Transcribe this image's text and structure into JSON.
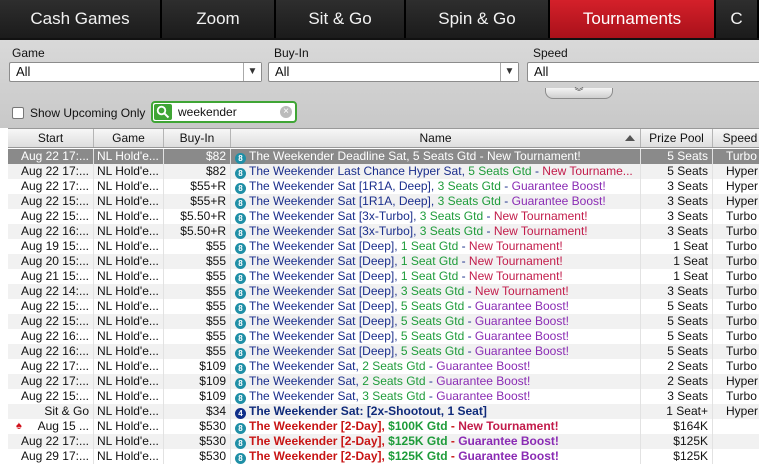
{
  "tabs": [
    {
      "label": "Cash Games",
      "width": 162,
      "active": false
    },
    {
      "label": "Zoom",
      "width": 114,
      "active": false
    },
    {
      "label": "Sit & Go",
      "width": 130,
      "active": false
    },
    {
      "label": "Spin & Go",
      "width": 144,
      "active": false
    },
    {
      "label": "Tournaments",
      "width": 166,
      "active": true
    },
    {
      "label": "C",
      "width": 43,
      "active": false
    }
  ],
  "filters": {
    "game": {
      "label": "Game",
      "value": "All"
    },
    "buyin": {
      "label": "Buy-In",
      "value": "All"
    },
    "speed": {
      "label": "Speed",
      "value": "All"
    },
    "show_upcoming_label": "Show Upcoming Only",
    "search_value": "weekender"
  },
  "columns": {
    "start": "Start",
    "game": "Game",
    "buyin": "Buy-In",
    "name": "Name",
    "prize": "Prize Pool",
    "speed": "Speed"
  },
  "colors": {
    "seats": "#1e9c3a",
    "boost": "#8a2bb4",
    "new_tournament": "#c21b4a",
    "name": "#1a2e8c",
    "red_name": "#c81515",
    "tab_active": "#c0161f",
    "search_border": "#3fa535"
  },
  "rows": [
    {
      "start": "Aug 22  17:...",
      "game": "NL Hold'e...",
      "buyin": "$82",
      "name": "The Weekender Deadline Sat",
      "seats": "5 Seats Gtd",
      "status": "New Tournament!",
      "prize": "5 Seats",
      "speed": "Turbo",
      "selected": true,
      "badge": "8"
    },
    {
      "start": "Aug 22  17:...",
      "game": "NL Hold'e...",
      "buyin": "$82",
      "name": "The Weekender Last Chance Hyper Sat",
      "seats": "5 Seats Gtd",
      "status": "New Tourname...",
      "prize": "5 Seats",
      "speed": "Hyper",
      "badge": "8"
    },
    {
      "start": "Aug 22  17:...",
      "game": "NL Hold'e...",
      "buyin": "$55+R",
      "name": "The Weekender Sat [1R1A, Deep]",
      "seats": "3 Seats Gtd",
      "status": "Guarantee Boost!",
      "prize": "3 Seats",
      "speed": "Hyper",
      "badge": "8"
    },
    {
      "start": "Aug 22  15:...",
      "game": "NL Hold'e...",
      "buyin": "$55+R",
      "name": "The Weekender Sat [1R1A, Deep]",
      "seats": "3 Seats Gtd",
      "status": "Guarantee Boost!",
      "prize": "3 Seats",
      "speed": "Hyper",
      "badge": "8"
    },
    {
      "start": "Aug 22  15:...",
      "game": "NL Hold'e...",
      "buyin": "$5.50+R",
      "name": "The Weekender Sat [3x-Turbo]",
      "seats": "3 Seats Gtd",
      "status": "New Tournament!",
      "prize": "3 Seats",
      "speed": "Turbo",
      "badge": "8"
    },
    {
      "start": "Aug 22  16:...",
      "game": "NL Hold'e...",
      "buyin": "$5.50+R",
      "name": "The Weekender Sat [3x-Turbo]",
      "seats": "3 Seats Gtd",
      "status": "New Tournament!",
      "prize": "3 Seats",
      "speed": "Turbo",
      "badge": "8"
    },
    {
      "start": "Aug 19  15:...",
      "game": "NL Hold'e...",
      "buyin": "$55",
      "name": "The Weekender Sat [Deep]",
      "seats": "1 Seat Gtd",
      "status": "New Tournament!",
      "prize": "1 Seat",
      "speed": "Turbo",
      "badge": "8"
    },
    {
      "start": "Aug 20  15:...",
      "game": "NL Hold'e...",
      "buyin": "$55",
      "name": "The Weekender Sat [Deep]",
      "seats": "1 Seat Gtd",
      "status": "New Tournament!",
      "prize": "1 Seat",
      "speed": "Turbo",
      "badge": "8"
    },
    {
      "start": "Aug 21  15:...",
      "game": "NL Hold'e...",
      "buyin": "$55",
      "name": "The Weekender Sat [Deep]",
      "seats": "1 Seat Gtd",
      "status": "New Tournament!",
      "prize": "1 Seat",
      "speed": "Turbo",
      "badge": "8"
    },
    {
      "start": "Aug 22  14:...",
      "game": "NL Hold'e...",
      "buyin": "$55",
      "name": "The Weekender Sat [Deep]",
      "seats": "3 Seats Gtd",
      "status": "New Tournament!",
      "prize": "3 Seats",
      "speed": "Turbo",
      "badge": "8"
    },
    {
      "start": "Aug 22  15:...",
      "game": "NL Hold'e...",
      "buyin": "$55",
      "name": "The Weekender Sat [Deep]",
      "seats": "5 Seats Gtd",
      "status": "Guarantee Boost!",
      "prize": "5 Seats",
      "speed": "Turbo",
      "badge": "8"
    },
    {
      "start": "Aug 22  15:...",
      "game": "NL Hold'e...",
      "buyin": "$55",
      "name": "The Weekender Sat [Deep]",
      "seats": "5 Seats Gtd",
      "status": "Guarantee Boost!",
      "prize": "5 Seats",
      "speed": "Turbo",
      "badge": "8"
    },
    {
      "start": "Aug 22  16:...",
      "game": "NL Hold'e...",
      "buyin": "$55",
      "name": "The Weekender Sat [Deep]",
      "seats": "5 Seats Gtd",
      "status": "Guarantee Boost!",
      "prize": "5 Seats",
      "speed": "Turbo",
      "badge": "8"
    },
    {
      "start": "Aug 22  16:...",
      "game": "NL Hold'e...",
      "buyin": "$55",
      "name": "The Weekender Sat [Deep]",
      "seats": "5 Seats Gtd",
      "status": "Guarantee Boost!",
      "prize": "5 Seats",
      "speed": "Turbo",
      "badge": "8"
    },
    {
      "start": "Aug 22  17:...",
      "game": "NL Hold'e...",
      "buyin": "$109",
      "name": "The Weekender Sat",
      "seats": "2 Seats Gtd",
      "status": "Guarantee Boost!",
      "prize": "2 Seats",
      "speed": "Turbo",
      "badge": "8"
    },
    {
      "start": "Aug 22  17:...",
      "game": "NL Hold'e...",
      "buyin": "$109",
      "name": "The Weekender Sat",
      "seats": "2 Seats Gtd",
      "status": "Guarantee Boost!",
      "prize": "2 Seats",
      "speed": "Hyper",
      "badge": "8"
    },
    {
      "start": "Aug 22  15:...",
      "game": "NL Hold'e...",
      "buyin": "$109",
      "name": "The Weekender Sat",
      "seats": "3 Seats Gtd",
      "status": "Guarantee Boost!",
      "prize": "3 Seats",
      "speed": "Turbo",
      "badge": "8"
    },
    {
      "start": "Sit & Go",
      "game": "NL Hold'e...",
      "buyin": "$34",
      "name": "The Weekender Sat: [2x-Shootout, 1 Seat]",
      "seats": "",
      "status": "",
      "prize": "1 Seat+",
      "speed": "Hyper",
      "badge": "4",
      "variant": "dark"
    },
    {
      "start": "Aug 15  ...",
      "game": "NL Hold'e...",
      "buyin": "$530",
      "name": "The Weekender [2-Day]",
      "seats": "$100K Gtd",
      "status": "New Tournament!",
      "prize": "$164K",
      "speed": "",
      "badge": "8",
      "variant": "red",
      "suit": "♠"
    },
    {
      "start": "Aug 22  17:...",
      "game": "NL Hold'e...",
      "buyin": "$530",
      "name": "The Weekender [2-Day]",
      "seats": "$125K Gtd",
      "status": "Guarantee Boost!",
      "prize": "$125K",
      "speed": "",
      "badge": "8",
      "variant": "red"
    },
    {
      "start": "Aug 29  17:...",
      "game": "NL Hold'e...",
      "buyin": "$530",
      "name": "The Weekender [2-Day]",
      "seats": "$125K Gtd",
      "status": "Guarantee Boost!",
      "prize": "$125K",
      "speed": "",
      "badge": "8",
      "variant": "red"
    }
  ]
}
